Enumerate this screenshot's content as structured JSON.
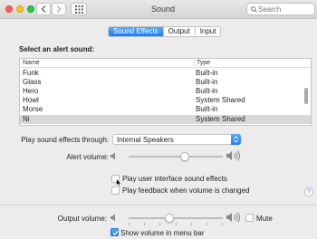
{
  "window": {
    "title": "Sound"
  },
  "search": {
    "placeholder": "Search",
    "value": ""
  },
  "tabs": [
    {
      "label": "Sound Effects",
      "active": true
    },
    {
      "label": "Output",
      "active": false
    },
    {
      "label": "Input",
      "active": false
    }
  ],
  "alerts": {
    "section_label": "Select an alert sound:",
    "columns": {
      "name": "Name",
      "type": "Type"
    },
    "rows": [
      {
        "name": "Funk",
        "type": "Built-in"
      },
      {
        "name": "Glass",
        "type": "Built-in"
      },
      {
        "name": "Hero",
        "type": "Built-in"
      },
      {
        "name": "Howl",
        "type": "System Shared"
      },
      {
        "name": "Morse",
        "type": "Built-in"
      },
      {
        "name": "Ni",
        "type": "System Shared",
        "selected": true
      }
    ]
  },
  "play_through": {
    "label": "Play sound effects through:",
    "value": "Internal Speakers"
  },
  "alert_volume": {
    "label": "Alert volume:",
    "level": 0.6
  },
  "options": {
    "ui_sounds": {
      "label": "Play user interface sound effects",
      "checked": false
    },
    "feedback": {
      "label": "Play feedback when volume is changed",
      "checked": false
    }
  },
  "output_volume": {
    "label": "Output volume:",
    "level": 0.43,
    "mute_label": "Mute",
    "muted": false
  },
  "menu_bar": {
    "label": "Show volume in menu bar",
    "checked": true
  },
  "colors": {
    "accent": "#1c7cf4",
    "selected_row": "#d8d8d8"
  }
}
